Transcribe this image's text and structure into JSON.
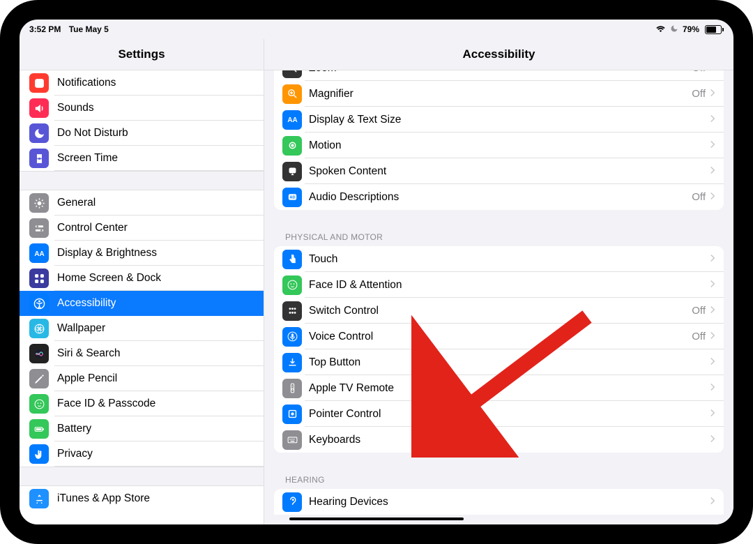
{
  "status": {
    "time": "3:52 PM",
    "date": "Tue May 5",
    "battery_pct": "79%",
    "battery_fill": 0.79
  },
  "titles": {
    "master": "Settings",
    "detail": "Accessibility"
  },
  "sidebar": {
    "groups": [
      {
        "items": [
          {
            "label": "Notifications",
            "icon": "notifications",
            "color": "#ff3b30"
          },
          {
            "label": "Sounds",
            "icon": "sounds",
            "color": "#ff2d55"
          },
          {
            "label": "Do Not Disturb",
            "icon": "dnd",
            "color": "#5856d6"
          },
          {
            "label": "Screen Time",
            "icon": "screentime",
            "color": "#5856d6"
          }
        ]
      },
      {
        "items": [
          {
            "label": "General",
            "icon": "general",
            "color": "#8e8e93"
          },
          {
            "label": "Control Center",
            "icon": "cc",
            "color": "#8e8e93"
          },
          {
            "label": "Display & Brightness",
            "icon": "display",
            "color": "#007aff"
          },
          {
            "label": "Home Screen & Dock",
            "icon": "home",
            "color": "#3a3a9f"
          },
          {
            "label": "Accessibility",
            "icon": "accessibility",
            "color": "#007aff",
            "selected": true
          },
          {
            "label": "Wallpaper",
            "icon": "wallpaper",
            "color": "#28b8e5"
          },
          {
            "label": "Siri & Search",
            "icon": "siri",
            "color": "#222222"
          },
          {
            "label": "Apple Pencil",
            "icon": "pencil",
            "color": "#8e8e93"
          },
          {
            "label": "Face ID & Passcode",
            "icon": "faceid",
            "color": "#34c759"
          },
          {
            "label": "Battery",
            "icon": "battery",
            "color": "#34c759"
          },
          {
            "label": "Privacy",
            "icon": "privacy",
            "color": "#007aff"
          }
        ]
      },
      {
        "items": [
          {
            "label": "iTunes & App Store",
            "icon": "appstore",
            "color": "#1e90ff"
          }
        ]
      }
    ]
  },
  "detail": {
    "groups": [
      {
        "header": null,
        "partial_top": true,
        "items": [
          {
            "label": "Zoom",
            "icon": "zoom",
            "color": "#333",
            "value": "Off"
          },
          {
            "label": "Magnifier",
            "icon": "magnifier",
            "color": "#ff9500",
            "value": "Off"
          },
          {
            "label": "Display & Text Size",
            "icon": "textsize",
            "color": "#007aff"
          },
          {
            "label": "Motion",
            "icon": "motion",
            "color": "#34c759"
          },
          {
            "label": "Spoken Content",
            "icon": "spoken",
            "color": "#333"
          },
          {
            "label": "Audio Descriptions",
            "icon": "audiodesc",
            "color": "#007aff",
            "value": "Off"
          }
        ]
      },
      {
        "header": "Physical and Motor",
        "items": [
          {
            "label": "Touch",
            "icon": "touch",
            "color": "#007aff"
          },
          {
            "label": "Face ID & Attention",
            "icon": "faceid2",
            "color": "#34c759"
          },
          {
            "label": "Switch Control",
            "icon": "switch",
            "color": "#333",
            "value": "Off"
          },
          {
            "label": "Voice Control",
            "icon": "voice",
            "color": "#007aff",
            "value": "Off"
          },
          {
            "label": "Top Button",
            "icon": "topbtn",
            "color": "#007aff"
          },
          {
            "label": "Apple TV Remote",
            "icon": "tvremote",
            "color": "#8e8e93"
          },
          {
            "label": "Pointer Control",
            "icon": "pointer",
            "color": "#007aff"
          },
          {
            "label": "Keyboards",
            "icon": "keyboards",
            "color": "#8e8e93"
          }
        ]
      },
      {
        "header": "Hearing",
        "partial_bottom": true,
        "items": [
          {
            "label": "Hearing Devices",
            "icon": "hearing",
            "color": "#007aff"
          }
        ]
      }
    ]
  },
  "annotation": {
    "target_label": "Pointer Control"
  }
}
